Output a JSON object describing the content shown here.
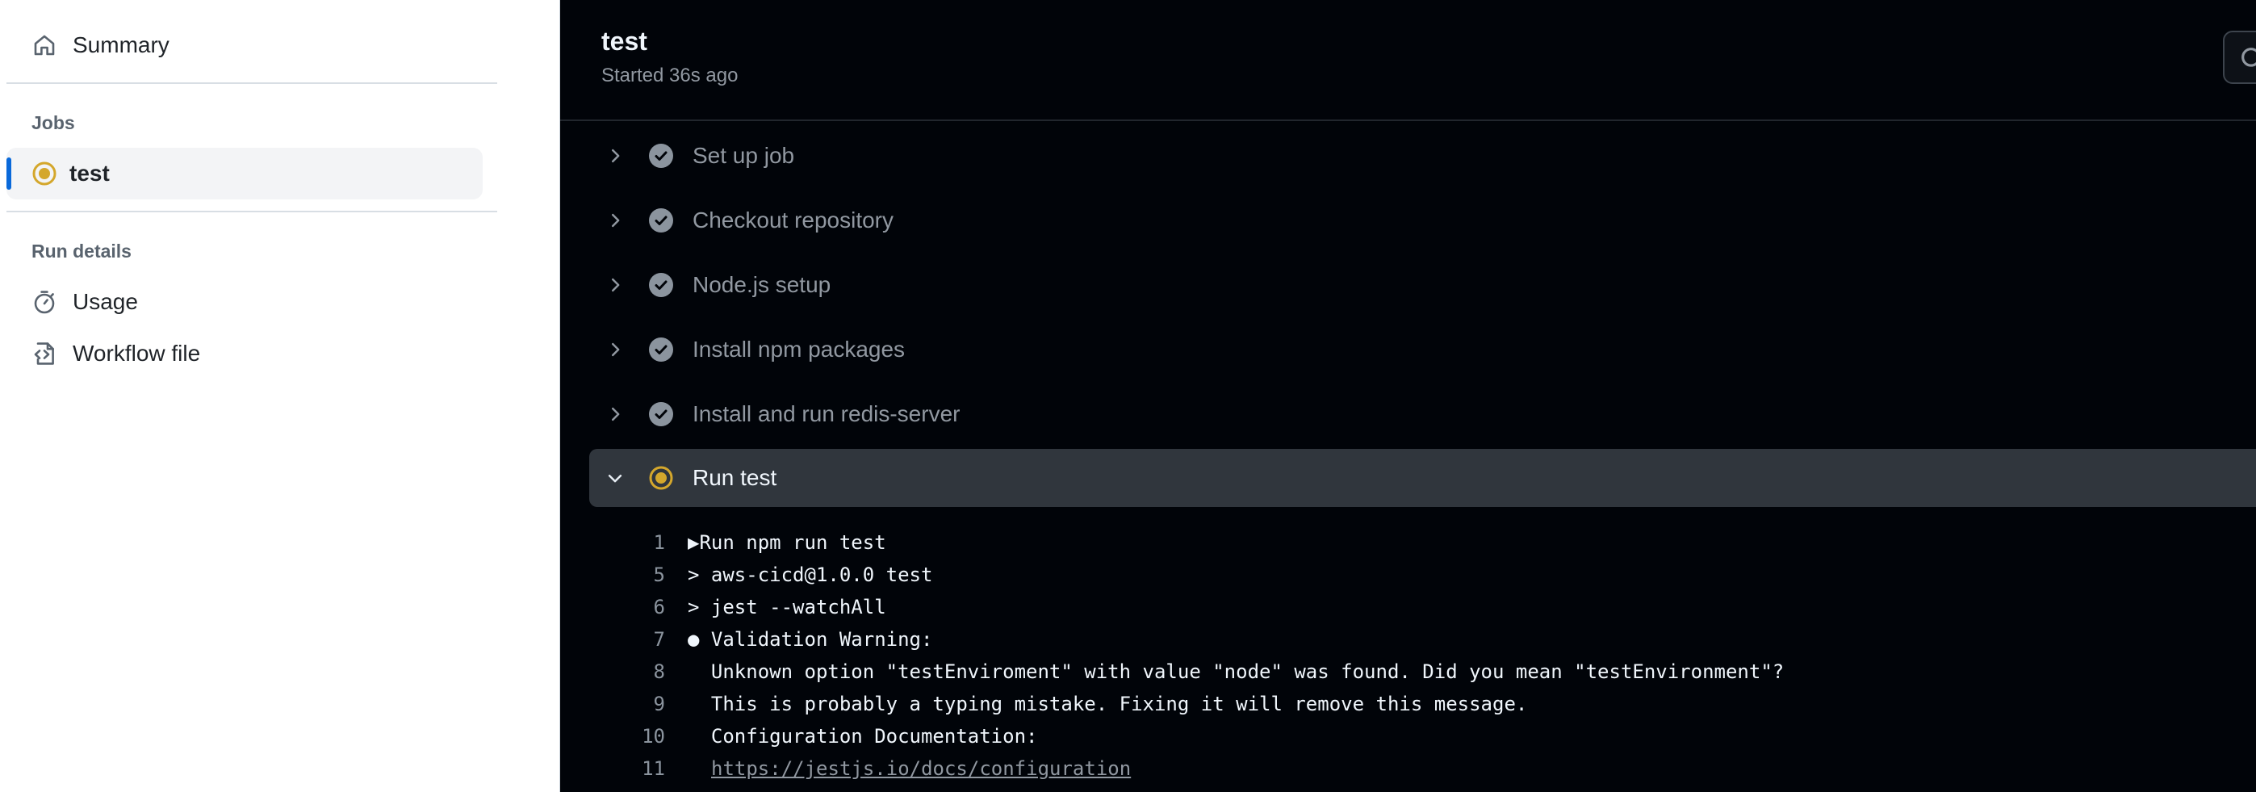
{
  "sidebar": {
    "summary_label": "Summary",
    "jobs_heading": "Jobs",
    "jobs": [
      {
        "label": "test",
        "status": "in-progress"
      }
    ],
    "run_details_heading": "Run details",
    "usage_label": "Usage",
    "workflow_file_label": "Workflow file"
  },
  "job": {
    "title": "test",
    "subtitle": "Started 36s ago"
  },
  "steps": [
    {
      "label": "Set up job",
      "status": "success"
    },
    {
      "label": "Checkout repository",
      "status": "success"
    },
    {
      "label": "Node.js setup",
      "status": "success"
    },
    {
      "label": "Install npm packages",
      "status": "success"
    },
    {
      "label": "Install and run redis-server",
      "status": "success"
    },
    {
      "label": "Run test",
      "status": "in-progress",
      "expanded": true
    }
  ],
  "log_lines": [
    {
      "number": "1",
      "text": "▶Run npm run test"
    },
    {
      "number": "5",
      "text": "> aws-cicd@1.0.0 test"
    },
    {
      "number": "6",
      "text": "> jest --watchAll"
    },
    {
      "number": "7",
      "text": "● Validation Warning:"
    },
    {
      "number": "8",
      "text": "  Unknown option \"testEnviroment\" with value \"node\" was found. Did you mean \"testEnvironment\"?"
    },
    {
      "number": "9",
      "text": "  This is probably a typing mistake. Fixing it will remove this message."
    },
    {
      "number": "10",
      "text": "  Configuration Documentation:"
    },
    {
      "number": "11",
      "text": "https://jestjs.io/docs/configuration"
    }
  ],
  "colors": {
    "accent_blue": "#0969da",
    "in_progress_yellow": "#d4a72c",
    "check_gray": "#8b949e",
    "main_bg": "#010409"
  }
}
